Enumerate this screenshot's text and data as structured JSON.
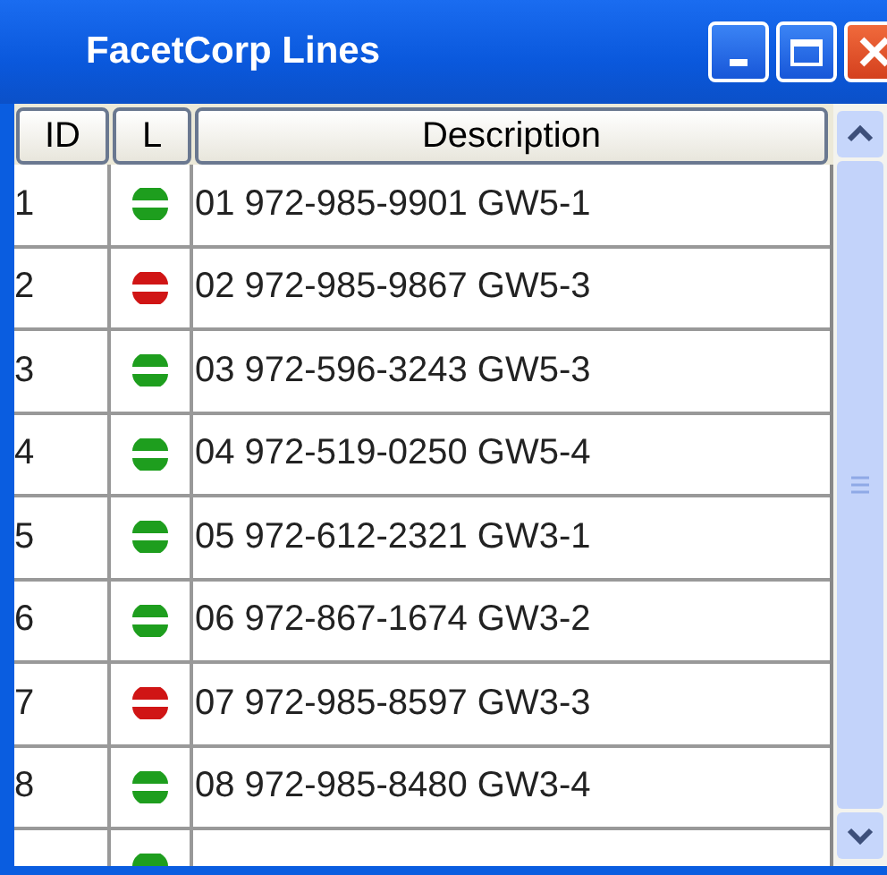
{
  "window": {
    "title": "FacetCorp Lines"
  },
  "table": {
    "columns": [
      "ID",
      "L",
      "Description"
    ],
    "rows": [
      {
        "id": "1",
        "color": "#1e9e1e",
        "description": "01 972-985-9901 GW5-1"
      },
      {
        "id": "2",
        "color": "#d01515",
        "description": "02 972-985-9867 GW5-3"
      },
      {
        "id": "3",
        "color": "#1e9e1e",
        "description": "03 972-596-3243 GW5-3"
      },
      {
        "id": "4",
        "color": "#1e9e1e",
        "description": "04 972-519-0250 GW5-4"
      },
      {
        "id": "5",
        "color": "#1e9e1e",
        "description": "05 972-612-2321 GW3-1"
      },
      {
        "id": "6",
        "color": "#1e9e1e",
        "description": "06 972-867-1674 GW3-2"
      },
      {
        "id": "7",
        "color": "#d01515",
        "description": "07 972-985-8597 GW3-3"
      },
      {
        "id": "8",
        "color": "#1e9e1e",
        "description": "08 972-985-8480 GW3-4"
      },
      {
        "color": "#1e9e1e"
      }
    ]
  }
}
